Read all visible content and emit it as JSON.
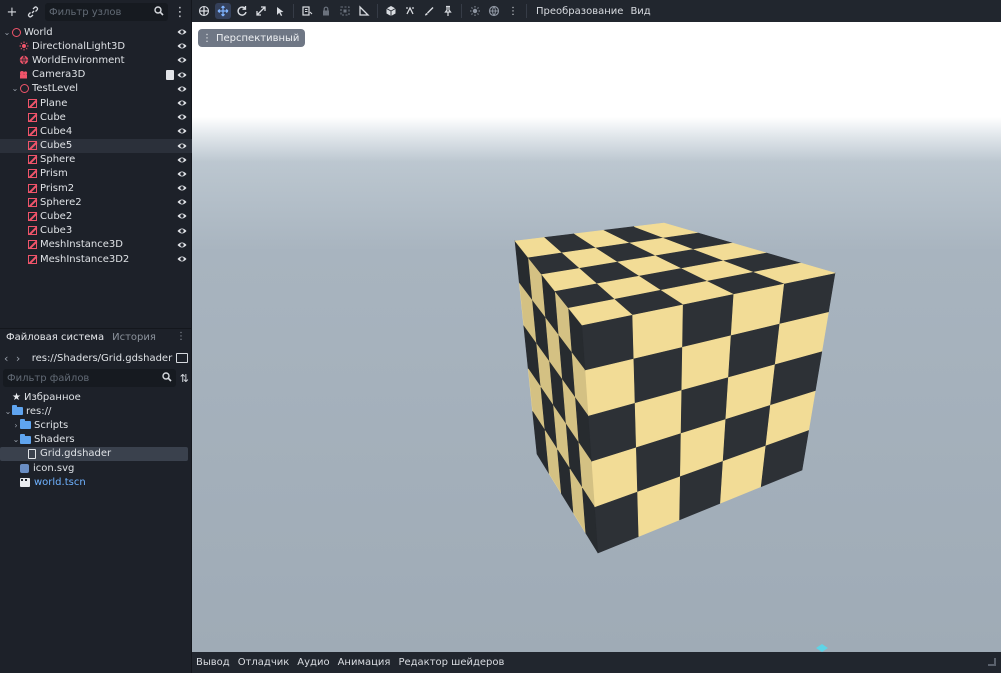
{
  "scene_dock": {
    "filter_placeholder": "Фильтр узлов",
    "nodes": [
      {
        "label": "World",
        "icon": "node3d-icon",
        "depth": 0,
        "expanded": true
      },
      {
        "label": "DirectionalLight3D",
        "icon": "directional-light-icon",
        "depth": 1
      },
      {
        "label": "WorldEnvironment",
        "icon": "world-environment-icon",
        "depth": 1
      },
      {
        "label": "Camera3D",
        "icon": "camera-icon",
        "depth": 1,
        "has_script": true
      },
      {
        "label": "TestLevel",
        "icon": "node3d-icon",
        "depth": 1,
        "expanded": true
      },
      {
        "label": "Plane",
        "icon": "mesh-instance-icon",
        "depth": 2
      },
      {
        "label": "Cube",
        "icon": "mesh-instance-icon",
        "depth": 2
      },
      {
        "label": "Cube4",
        "icon": "mesh-instance-icon",
        "depth": 2
      },
      {
        "label": "Cube5",
        "icon": "mesh-instance-icon",
        "depth": 2,
        "selected": true
      },
      {
        "label": "Sphere",
        "icon": "mesh-instance-icon",
        "depth": 2
      },
      {
        "label": "Prism",
        "icon": "mesh-instance-icon",
        "depth": 2
      },
      {
        "label": "Prism2",
        "icon": "mesh-instance-icon",
        "depth": 2
      },
      {
        "label": "Sphere2",
        "icon": "mesh-instance-icon",
        "depth": 2
      },
      {
        "label": "Cube2",
        "icon": "mesh-instance-icon",
        "depth": 2
      },
      {
        "label": "Cube3",
        "icon": "mesh-instance-icon",
        "depth": 2
      },
      {
        "label": "MeshInstance3D",
        "icon": "mesh-instance-icon",
        "depth": 2
      },
      {
        "label": "MeshInstance3D2",
        "icon": "mesh-instance-icon",
        "depth": 2
      }
    ]
  },
  "filesystem": {
    "tab_active": "Файловая система",
    "tab_other": "История",
    "path": "res://Shaders/Grid.gdshader",
    "filter_placeholder": "Фильтр файлов",
    "items": [
      {
        "label": "Избранное",
        "icon": "star-icon",
        "depth": 0
      },
      {
        "label": "res://",
        "icon": "folder-icon",
        "depth": 0,
        "expanded": true
      },
      {
        "label": "Scripts",
        "icon": "folder-icon",
        "depth": 1,
        "expanded": false
      },
      {
        "label": "Shaders",
        "icon": "folder-icon",
        "depth": 1,
        "expanded": true
      },
      {
        "label": "Grid.gdshader",
        "icon": "shader-file-icon",
        "depth": 2,
        "selected": true
      },
      {
        "label": "icon.svg",
        "icon": "image-file-icon",
        "depth": 1
      },
      {
        "label": "world.tscn",
        "icon": "scene-file-icon",
        "depth": 1,
        "link": true
      }
    ]
  },
  "toolbar": {
    "menu_transform": "Преобразование",
    "menu_view": "Вид"
  },
  "viewport": {
    "perspective_label": "Перспективный"
  },
  "bottom_panel": {
    "tabs": [
      "Вывод",
      "Отладчик",
      "Аудио",
      "Анимация",
      "Редактор шейдеров"
    ]
  },
  "colors": {
    "accent": "#7fb3ff",
    "node_icon": "#f0546a",
    "checker_light": "#f2dc96",
    "checker_dark": "#2d3136"
  }
}
